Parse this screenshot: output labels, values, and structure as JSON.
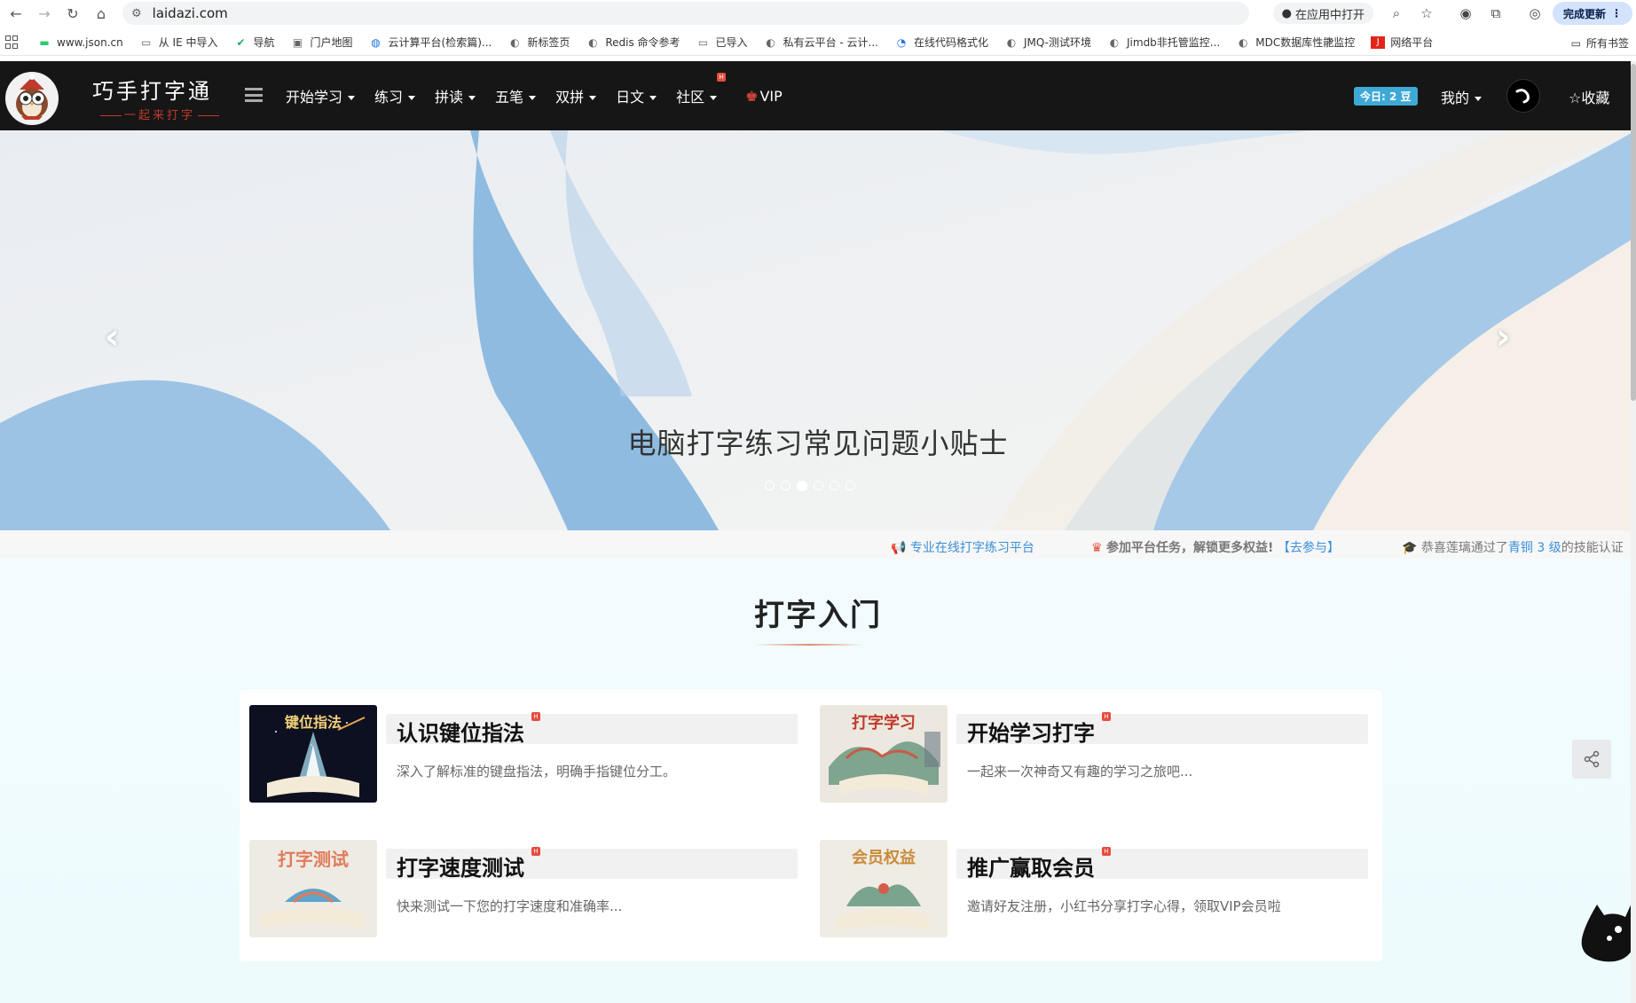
{
  "browser": {
    "url": "laidazi.com",
    "open_in_app": "在应用中打开",
    "update_label": "完成更新",
    "bookmarks": [
      {
        "label": "www.json.cn",
        "icon": "json-icon"
      },
      {
        "label": "从 IE 中导入",
        "icon": "folder-icon"
      },
      {
        "label": "导航",
        "icon": "check-icon"
      },
      {
        "label": "门户地图",
        "icon": "map-icon"
      },
      {
        "label": "云计算平台(检索篇)...",
        "icon": "cloud-icon"
      },
      {
        "label": "新标签页",
        "icon": "globe-icon"
      },
      {
        "label": "Redis 命令参考",
        "icon": "globe-icon"
      },
      {
        "label": "已导入",
        "icon": "folder-icon"
      },
      {
        "label": "私有云平台 - 云计...",
        "icon": "globe-icon"
      },
      {
        "label": "在线代码格式化",
        "icon": "code-icon"
      },
      {
        "label": "JMQ-测试环境",
        "icon": "globe-icon"
      },
      {
        "label": "Jimdb非托管监控...",
        "icon": "globe-icon"
      },
      {
        "label": "MDC数据库性能监控",
        "icon": "globe-icon"
      },
      {
        "label": "网络平台",
        "icon": "jd-icon"
      }
    ],
    "more": "»",
    "all_bookmarks": "所有书签"
  },
  "site": {
    "logo_text": "巧手打字通",
    "logo_sub": "一起来打字",
    "nav": [
      {
        "label": "开始学习",
        "caret": true
      },
      {
        "label": "练习",
        "caret": true
      },
      {
        "label": "拼读",
        "caret": true
      },
      {
        "label": "五笔",
        "caret": true
      },
      {
        "label": "双拼",
        "caret": true
      },
      {
        "label": "日文",
        "caret": true
      },
      {
        "label": "社区",
        "caret": true,
        "hot": true
      }
    ],
    "vip": "VIP",
    "today": "今日: 2 豆",
    "mine": "我的",
    "favorite": "☆收藏"
  },
  "hero": {
    "title": "电脑打字练习常见问题小贴士",
    "slide_count": 6,
    "active_slide": 3
  },
  "ticker": [
    {
      "text": "专业在线打字练习平台",
      "link": ""
    },
    {
      "text": "参加平台任务，解锁更多权益!",
      "link": "【去参与】"
    },
    {
      "text": "恭喜莲璃通过了",
      "level": "青铜 3 级",
      "suffix": "的技能认证"
    }
  ],
  "section": {
    "title": "打字入门",
    "cards": [
      {
        "title": "认识键位指法",
        "desc": "深入了解标准的键盘指法，明确手指键位分工。",
        "thumb_label": "键位指法"
      },
      {
        "title": "开始学习打字",
        "desc": "一起来一次神奇又有趣的学习之旅吧...",
        "thumb_label": "打字学习"
      },
      {
        "title": "打字速度测试",
        "desc": "快来测试一下您的打字速度和准确率...",
        "thumb_label": "打字测试"
      },
      {
        "title": "推广赢取会员",
        "desc": "邀请好友注册，小红书分享打字心得，领取VIP会员啦",
        "thumb_label": "会员权益"
      }
    ]
  },
  "hot_mark": "H",
  "colors": {
    "header_bg": "#161616",
    "accent_red": "#e74c3c",
    "badge_blue": "#3fa9d6",
    "link_blue": "#3a8fd9"
  }
}
